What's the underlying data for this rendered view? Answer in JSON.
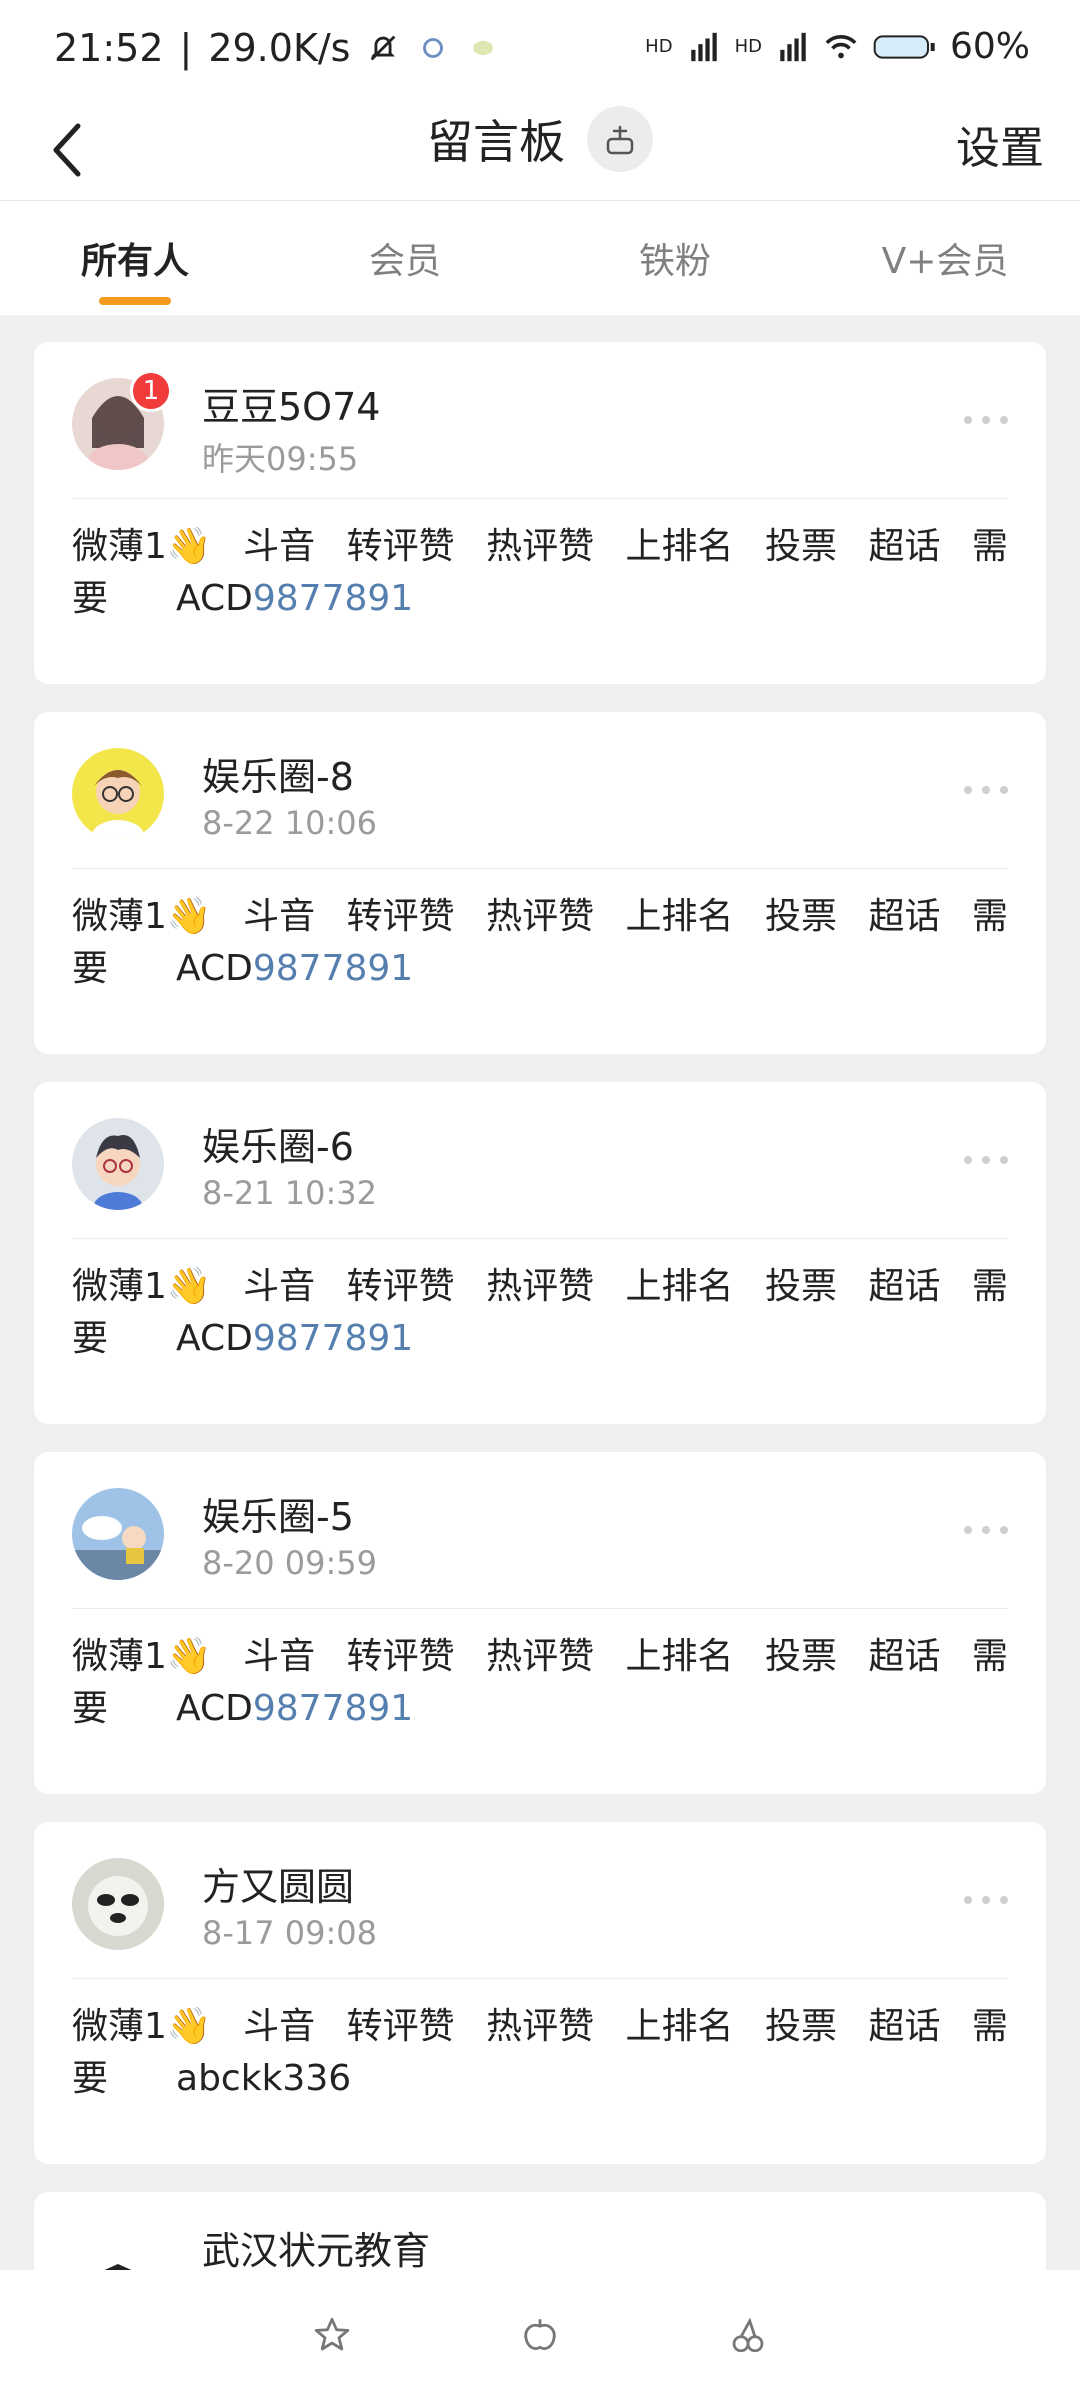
{
  "status_bar": {
    "time": "21:52",
    "speed": "29.0K/s",
    "battery": "60%",
    "signal_1": "HD",
    "signal_2": "HD"
  },
  "header": {
    "title": "留言板",
    "settings_label": "设置"
  },
  "tabs": [
    {
      "label": "所有人",
      "active": true
    },
    {
      "label": "会员",
      "active": false
    },
    {
      "label": "铁粉",
      "active": false
    },
    {
      "label": "V+会员",
      "active": false
    }
  ],
  "posts": [
    {
      "name": "豆豆5O74",
      "time": "昨天09:55",
      "badge": "1",
      "line1": [
        "微薄1👋",
        "斗音",
        "转评赞",
        "热评赞",
        "上排名",
        "投票",
        "超话",
        "需"
      ],
      "line2_prefix": "要",
      "code_prefix": "ACD",
      "code_number": "9877891"
    },
    {
      "name": "娱乐圈-8",
      "time": "8-22 10:06",
      "line1": [
        "微薄1👋",
        "斗音",
        "转评赞",
        "热评赞",
        "上排名",
        "投票",
        "超话",
        "需"
      ],
      "line2_prefix": "要",
      "code_prefix": "ACD",
      "code_number": "9877891"
    },
    {
      "name": "娱乐圈-6",
      "time": "8-21 10:32",
      "line1": [
        "微薄1👋",
        "斗音",
        "转评赞",
        "热评赞",
        "上排名",
        "投票",
        "超话",
        "需"
      ],
      "line2_prefix": "要",
      "code_prefix": "ACD",
      "code_number": "9877891"
    },
    {
      "name": "娱乐圈-5",
      "time": "8-20 09:59",
      "line1": [
        "微薄1👋",
        "斗音",
        "转评赞",
        "热评赞",
        "上排名",
        "投票",
        "超话",
        "需"
      ],
      "line2_prefix": "要",
      "code_prefix": "ACD",
      "code_number": "9877891"
    },
    {
      "name": "方又圆圆",
      "time": "8-17 09:08",
      "line1": [
        "微薄1👋",
        "斗音",
        "转评赞",
        "热评赞",
        "上排名",
        "投票",
        "超话",
        "需"
      ],
      "line2_prefix": "要",
      "code_prefix": "abckk336",
      "code_number": ""
    }
  ],
  "partial_post": {
    "name": "武汉状元教育"
  },
  "colors": {
    "accent": "#f39a1c",
    "link": "#557fae",
    "badge": "#f23b3b"
  }
}
